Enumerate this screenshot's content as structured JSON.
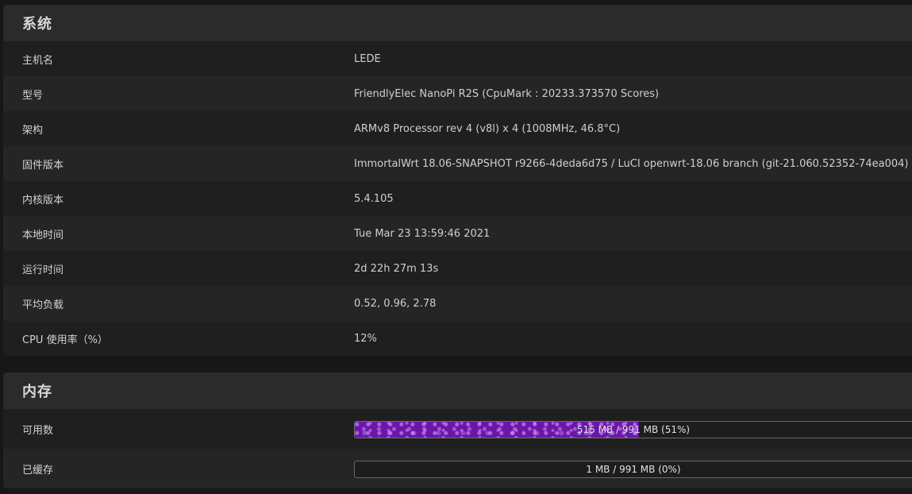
{
  "system": {
    "title": "系统",
    "rows": [
      {
        "label": "主机名",
        "value": "LEDE"
      },
      {
        "label": "型号",
        "value": "FriendlyElec NanoPi R2S (CpuMark : 20233.373570 Scores)"
      },
      {
        "label": "架构",
        "value": "ARMv8 Processor rev 4 (v8l) x 4 (1008MHz, 46.8°C)"
      },
      {
        "label": "固件版本",
        "value": "ImmortalWrt 18.06-SNAPSHOT r9266-4deda6d75 / LuCI openwrt-18.06 branch (git-21.060.52352-74ea004)"
      },
      {
        "label": "内核版本",
        "value": "5.4.105"
      },
      {
        "label": "本地时间",
        "value": "Tue Mar 23 13:59:46 2021"
      },
      {
        "label": "运行时间",
        "value": "2d 22h 27m 13s"
      },
      {
        "label": "平均负载",
        "value": "0.52, 0.96, 2.78"
      },
      {
        "label": "CPU 使用率（%）",
        "value": "12%"
      }
    ]
  },
  "memory": {
    "title": "内存",
    "rows": [
      {
        "label": "可用数",
        "text": "515 MB / 991 MB (51%)",
        "percent": 51,
        "fill_color": "#6a16a8"
      },
      {
        "label": "已缓存",
        "text": "1 MB / 991 MB (0%)",
        "percent": 0,
        "fill_color": "#6a16a8"
      }
    ]
  }
}
